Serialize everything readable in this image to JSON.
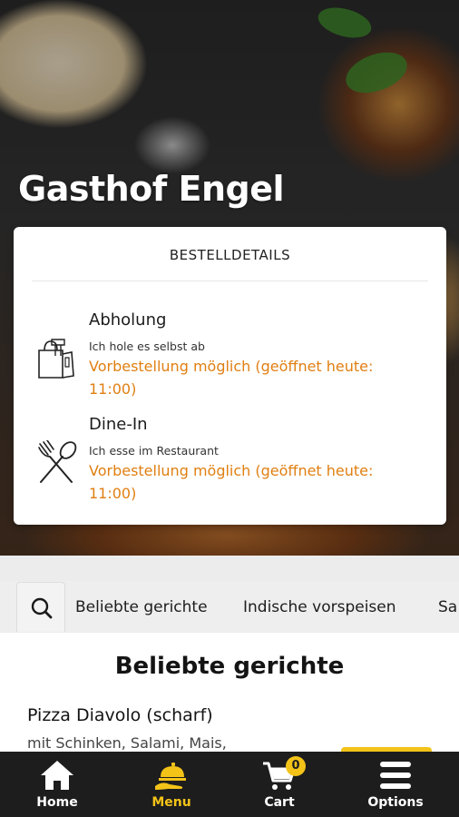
{
  "restaurant": {
    "name": "Gasthof Engel"
  },
  "order_details": {
    "heading": "BESTELLDETAILS",
    "options": [
      {
        "title": "Abholung",
        "subtitle": "Ich hole es selbst ab",
        "note": "Vorbestellung möglich (geöffnet heute: 11:00)",
        "icon": "takeaway-bag-icon"
      },
      {
        "title": "Dine-In",
        "subtitle": "Ich esse im Restaurant",
        "note": "Vorbestellung möglich (geöffnet heute: 11:00)",
        "icon": "fork-spoon-icon"
      }
    ]
  },
  "categories": {
    "search_icon": "search-icon",
    "items": [
      "Beliebte gerichte",
      "Indische vorspeisen",
      "Sa"
    ]
  },
  "menu": {
    "section_title": "Beliebte gerichte",
    "dishes": [
      {
        "name": "Pizza Diavolo (scharf)",
        "description": "mit Schinken, Salami, Mais,"
      }
    ]
  },
  "bottom_nav": {
    "items": [
      {
        "label": "Home",
        "icon": "home-icon",
        "active": false
      },
      {
        "label": "Menu",
        "icon": "menu-cloche-icon",
        "active": true
      },
      {
        "label": "Cart",
        "icon": "cart-icon",
        "active": false,
        "badge": "0"
      },
      {
        "label": "Options",
        "icon": "hamburger-icon",
        "active": false
      }
    ]
  },
  "colors": {
    "accent": "#f3c318",
    "note": "#e07f12",
    "nav_bg": "#1d1d1d"
  }
}
